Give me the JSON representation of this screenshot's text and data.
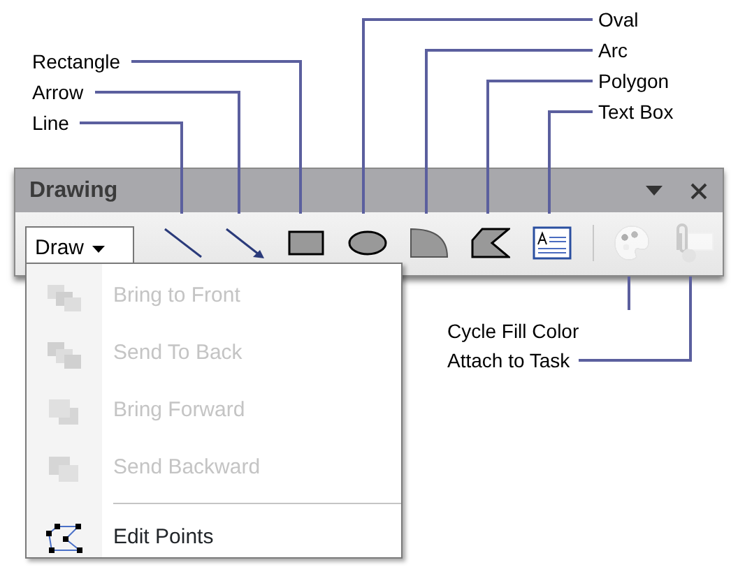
{
  "callouts": [
    {
      "text": "Rectangle"
    },
    {
      "text": "Arrow"
    },
    {
      "text": "Line"
    },
    {
      "text": "Oval"
    },
    {
      "text": "Arc"
    },
    {
      "text": "Polygon"
    },
    {
      "text": "Text Box"
    },
    {
      "text": "Cycle Fill Color"
    },
    {
      "text": "Attach to Task"
    }
  ],
  "toolbar": {
    "title": "Drawing",
    "draw_button": {
      "label": "Draw"
    },
    "tools": [
      {
        "kind": "line",
        "disabled": false
      },
      {
        "kind": "arrow",
        "disabled": false
      },
      {
        "kind": "rectangle",
        "disabled": false
      },
      {
        "kind": "oval",
        "disabled": false
      },
      {
        "kind": "arc",
        "disabled": false
      },
      {
        "kind": "polygon",
        "disabled": false
      },
      {
        "kind": "textbox",
        "disabled": false
      },
      {
        "kind": "separator"
      },
      {
        "kind": "palette",
        "disabled": true
      },
      {
        "kind": "attach",
        "disabled": true
      }
    ]
  },
  "menu": {
    "items": [
      {
        "label": "Bring to Front",
        "disabled": true
      },
      {
        "label": "Send To Back",
        "disabled": true
      },
      {
        "label": "Bring Forward",
        "disabled": true
      },
      {
        "label": "Send Backward",
        "disabled": true
      },
      {
        "kind": "separator"
      },
      {
        "label": "Edit Points",
        "disabled": false
      }
    ]
  }
}
